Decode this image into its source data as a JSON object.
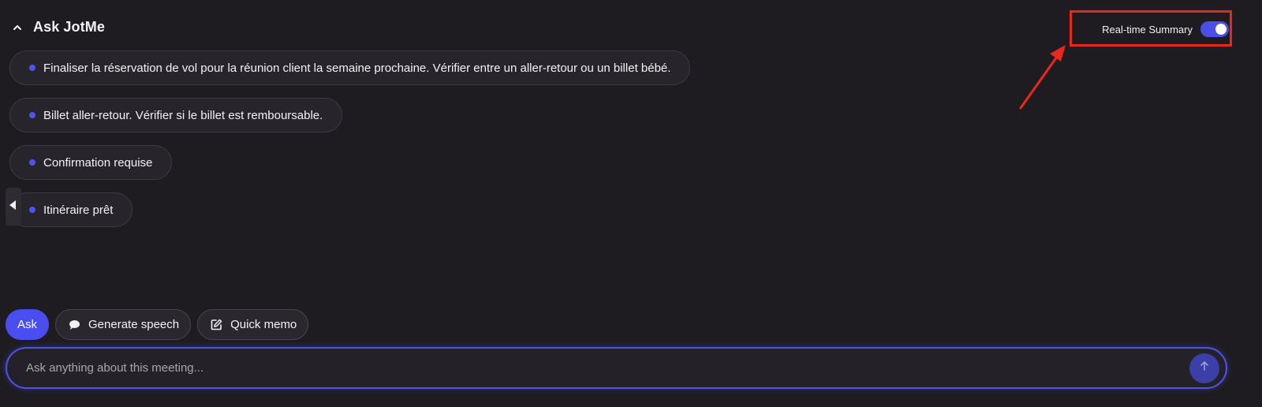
{
  "header": {
    "title": "Ask JotMe",
    "collapse_icon": "chevron-up-icon"
  },
  "realtime": {
    "label": "Real-time Summary",
    "enabled": true
  },
  "summary_items": [
    "Finaliser la réservation de vol pour la réunion client la semaine prochaine. Vérifier entre un aller-retour ou un billet bébé.",
    "Billet aller-retour. Vérifier si le billet est remboursable.",
    "Confirmation requise",
    "Itinéraire prêt"
  ],
  "actions": {
    "ask": "Ask",
    "generate_speech": "Generate speech",
    "quick_memo": "Quick memo"
  },
  "input": {
    "placeholder": "Ask anything about this meeting...",
    "value": ""
  },
  "colors": {
    "background": "#1e1c20",
    "accent": "#4a4ef0",
    "annotation": "#e8281f"
  }
}
